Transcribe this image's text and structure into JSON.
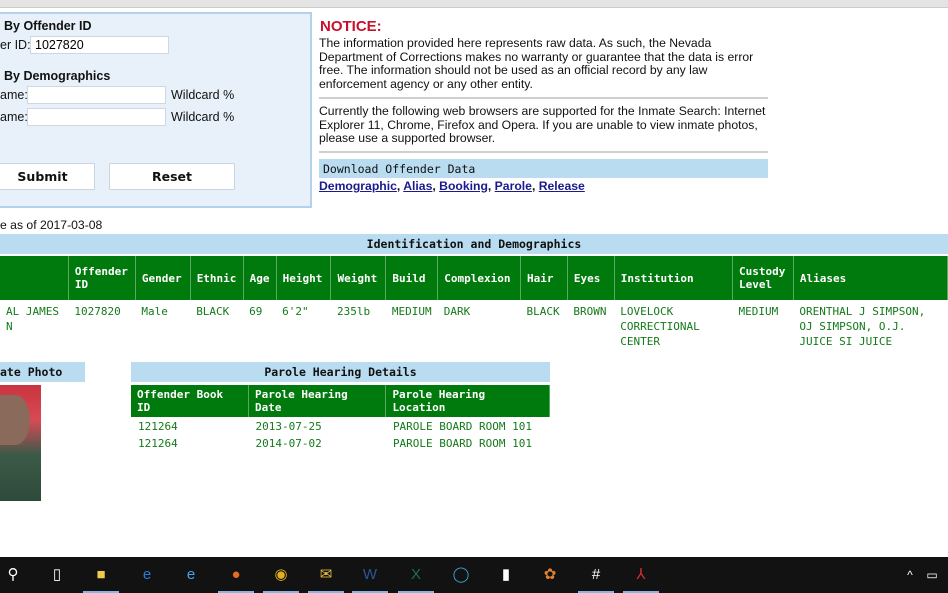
{
  "search_panel": {
    "by_id_title": "By Offender ID",
    "id_label": "er ID:",
    "id_value": "1027820",
    "by_demo_title": "By Demographics",
    "name1_label": "ame:",
    "name1_value": "",
    "name2_label": "ame:",
    "name2_value": "",
    "wildcard1": "Wildcard %",
    "wildcard2": "Wildcard %",
    "submit": "Submit",
    "reset": "Reset"
  },
  "notice": {
    "title": "NOTICE:",
    "p1": "The information provided here represents raw data. As such, the Nevada Department of Corrections makes no warranty or guarantee that the data is error free. The information should not be used as an official record by any law enforcement agency or any other entity.",
    "p2": "Currently the following web browsers are supported for the Inmate Search: Internet Explorer 11, Chrome, Firefox and Opera. If you are unable to view inmate photos, please use a supported browser.",
    "download_title": "Download Offender Data",
    "links": [
      "Demographic",
      "Alias",
      "Booking",
      "Parole",
      "Release"
    ]
  },
  "as_of": "e as of 2017-03-08",
  "demographics": {
    "title": "Identification and Demographics",
    "headers": [
      "",
      "Offender ID",
      "Gender",
      "Ethnic",
      "Age",
      "Height",
      "Weight",
      "Build",
      "Complexion",
      "Hair",
      "Eyes",
      "Institution",
      "Custody Level",
      "Aliases"
    ],
    "row": [
      "AL JAMES N",
      "1027820",
      "Male",
      "BLACK",
      "69",
      "6'2\"",
      "235lb",
      "MEDIUM",
      "DARK",
      "BLACK",
      "BROWN",
      "LOVELOCK CORRECTIONAL CENTER",
      "MEDIUM",
      "ORENTHAL J SIMPSON, OJ SIMPSON, O.J. JUICE SI JUICE"
    ]
  },
  "photo": {
    "title": "ate Photo"
  },
  "parole": {
    "title": "Parole Hearing Details",
    "headers": [
      "Offender Book ID",
      "Parole Hearing Date",
      "Parole Hearing Location"
    ],
    "rows": [
      [
        "121264",
        "2013-07-25",
        "PAROLE BOARD ROOM 101"
      ],
      [
        "121264",
        "2014-07-02",
        "PAROLE BOARD ROOM 101"
      ]
    ]
  },
  "taskbar": {
    "icons": [
      "search-icon",
      "task-view-icon",
      "file-explorer-icon",
      "edge-icon",
      "internet-explorer-icon",
      "firefox-icon",
      "chrome-icon",
      "mail-icon",
      "word-icon",
      "excel-icon",
      "circle-app-icon",
      "blank-document-icon",
      "paw-app-icon",
      "hash-app-icon",
      "acrobat-icon"
    ],
    "tray": [
      "chevron-up-icon",
      "battery-icon"
    ]
  },
  "colors": {
    "header_green": "#007a0c",
    "cell_green": "#147a1a",
    "bar_blue": "#b9dcf0",
    "notice_red": "#c8102e"
  }
}
